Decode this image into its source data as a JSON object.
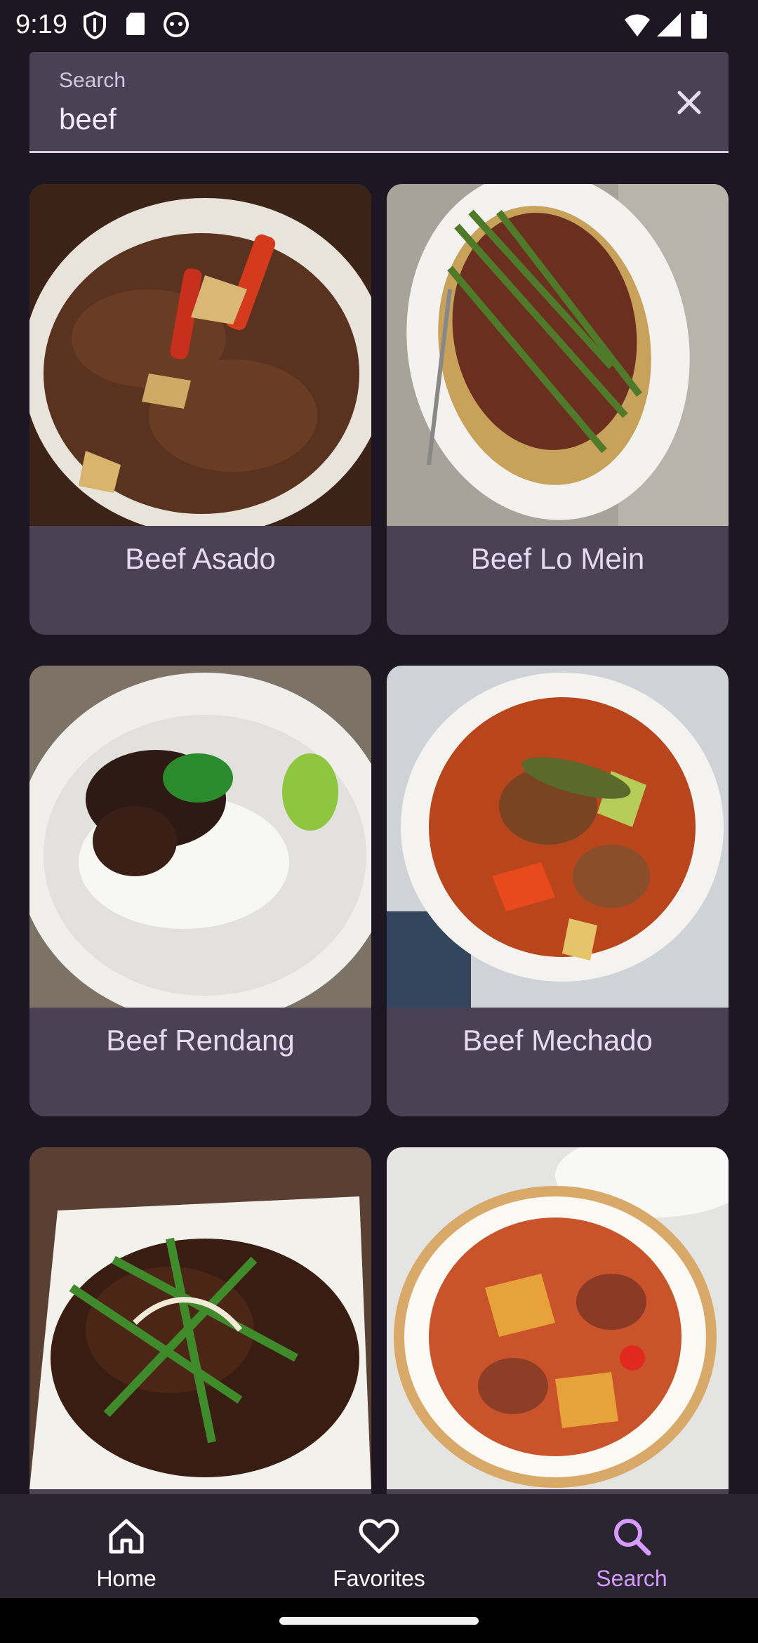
{
  "status_bar": {
    "time": "9:19"
  },
  "search": {
    "label": "Search",
    "value": "beef"
  },
  "results": [
    {
      "title": "Beef Asado"
    },
    {
      "title": "Beef Lo Mein"
    },
    {
      "title": "Beef Rendang"
    },
    {
      "title": "Beef Mechado"
    },
    {
      "title": ""
    },
    {
      "title": ""
    }
  ],
  "bottom_nav": {
    "items": [
      {
        "label": "Home",
        "icon": "home-icon"
      },
      {
        "label": "Favorites",
        "icon": "heart-icon"
      },
      {
        "label": "Search",
        "icon": "search-icon"
      }
    ],
    "active": "Search"
  },
  "colors": {
    "accent": "#d69bff",
    "surface": "#4a4155",
    "background": "#1c1722"
  }
}
